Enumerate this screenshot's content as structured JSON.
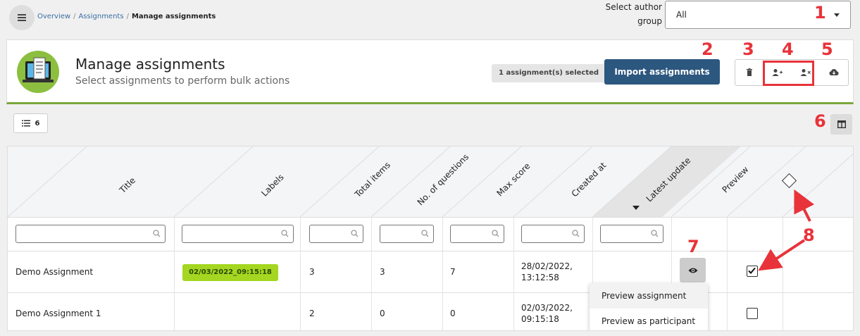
{
  "breadcrumb": {
    "items": [
      "Overview",
      "Assignments"
    ],
    "current": "Manage assignments",
    "separator": "/"
  },
  "author_group": {
    "label": "Select author group",
    "value": "All"
  },
  "page": {
    "title": "Manage assignments",
    "subtitle": "Select assignments to perform bulk actions"
  },
  "selection": {
    "badge": "1 assignment(s) selected"
  },
  "actions": {
    "import_label": "Import assignments",
    "icons": [
      "trash-icon",
      "add-user-icon",
      "remove-user-icon",
      "cloud-download-icon"
    ]
  },
  "toolbar": {
    "count": "6"
  },
  "table": {
    "columns": [
      "Title",
      "Labels",
      "Total items",
      "No. of questions",
      "Max score",
      "Created at",
      "Latest update",
      "Preview"
    ],
    "rows": [
      {
        "title": "Demo Assignment",
        "label": "02/03/2022_09:15:18",
        "total_items": "3",
        "questions": "3",
        "max_score": "7",
        "created_at": "28/02/2022,\n13:12:58",
        "checked": true
      },
      {
        "title": "Demo Assignment 1",
        "label": "",
        "total_items": "2",
        "questions": "0",
        "max_score": "0",
        "created_at": "02/03/2022,\n09:15:18",
        "checked": false
      }
    ]
  },
  "preview_menu": {
    "items": [
      "Preview assignment",
      "Preview as participant"
    ]
  },
  "annotations": [
    "1",
    "2",
    "3",
    "4",
    "5",
    "6",
    "7",
    "8"
  ],
  "colors": {
    "accent": "#2c577f",
    "brand_green": "#7aa83a",
    "chip": "#a5d621",
    "annotation": "#e8333a"
  }
}
